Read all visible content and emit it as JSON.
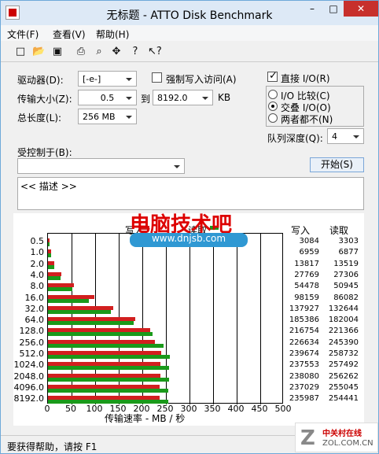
{
  "window": {
    "title": "无标题 - ATTO Disk Benchmark",
    "controls": [
      "–",
      "□",
      "✕"
    ]
  },
  "menus": [
    "文件(F)",
    "查看(V)",
    "帮助(H)"
  ],
  "toolbar_icons": [
    "new-icon",
    "open-icon",
    "save-icon",
    "print-icon",
    "preview-icon",
    "move-icon",
    "help-icon",
    "context-help-icon"
  ],
  "settings": {
    "drive_label": "驱动器(D):",
    "drive_value": "[-e-]",
    "force_write_label": "强制写入访问(A)",
    "transfer_label": "传输大小(Z):",
    "transfer_from": "0.5",
    "to_label": "到",
    "transfer_to": "8192.0",
    "unit": "KB",
    "length_label": "总长度(L):",
    "length_value": "256 MB",
    "direct_io_label": "直接 I/O(R)",
    "io_compare_label": "I/O 比较(C)",
    "overlap_io_label": "交叠 I/O(O)",
    "neither_label": "两者都不(N)",
    "queue_label": "队列深度(Q):",
    "queue_value": "4",
    "controlled_by_label": "受控制于(B):",
    "controlled_by_value": "",
    "start_button": "开始(S)",
    "description": "<< 描述 >>"
  },
  "results": {
    "header_write": "写入",
    "header_read": "读取",
    "rows": [
      {
        "size": "0.5",
        "write": 3084,
        "read": 3303
      },
      {
        "size": "1.0",
        "write": 6959,
        "read": 6877
      },
      {
        "size": "2.0",
        "write": 13817,
        "read": 13519
      },
      {
        "size": "4.0",
        "write": 27769,
        "read": 27306
      },
      {
        "size": "8.0",
        "write": 54478,
        "read": 50945
      },
      {
        "size": "16.0",
        "write": 98159,
        "read": 86082
      },
      {
        "size": "32.0",
        "write": 137927,
        "read": 132644
      },
      {
        "size": "64.0",
        "write": 185386,
        "read": 182004
      },
      {
        "size": "128.0",
        "write": 216754,
        "read": 221366
      },
      {
        "size": "256.0",
        "write": 226634,
        "read": 245390
      },
      {
        "size": "512.0",
        "write": 239674,
        "read": 258732
      },
      {
        "size": "1024.0",
        "write": 237553,
        "read": 257492
      },
      {
        "size": "2048.0",
        "write": 238080,
        "read": 256262
      },
      {
        "size": "4096.0",
        "write": 237029,
        "read": 255045
      },
      {
        "size": "8192.0",
        "write": 235987,
        "read": 254441
      }
    ]
  },
  "chart_data": {
    "type": "bar",
    "categories": [
      "0.5",
      "1.0",
      "2.0",
      "4.0",
      "8.0",
      "16.0",
      "32.0",
      "64.0",
      "128.0",
      "256.0",
      "512.0",
      "1024.0",
      "2048.0",
      "4096.0",
      "8192.0"
    ],
    "series": [
      {
        "name": "写入",
        "values": [
          3.084,
          6.959,
          13.817,
          27.769,
          54.478,
          98.159,
          137.927,
          185.386,
          216.754,
          226.634,
          239.674,
          237.553,
          238.08,
          237.029,
          235.987
        ],
        "color": "#d21f1f"
      },
      {
        "name": "读取",
        "values": [
          3.303,
          6.877,
          13.519,
          27.306,
          50.945,
          86.082,
          132.644,
          182.004,
          221.366,
          245.39,
          258.732,
          257.492,
          256.262,
          255.045,
          254.441
        ],
        "color": "#1a9a1a"
      }
    ],
    "xlabel": "传输速率 - MB / 秒",
    "x_ticks": [
      "0",
      "50",
      "100",
      "150",
      "200",
      "250",
      "300",
      "350",
      "400",
      "450",
      "500"
    ],
    "xlim": [
      0,
      500
    ],
    "grid": true,
    "legend": "top"
  },
  "watermark": {
    "text": "电脑技术吧",
    "subtext": "www.dnjsb.com"
  },
  "corner_logo": {
    "text1": "中关村在线",
    "text2": "ZOL.COM.CN"
  },
  "status_text": "要获得帮助，请按 F1"
}
